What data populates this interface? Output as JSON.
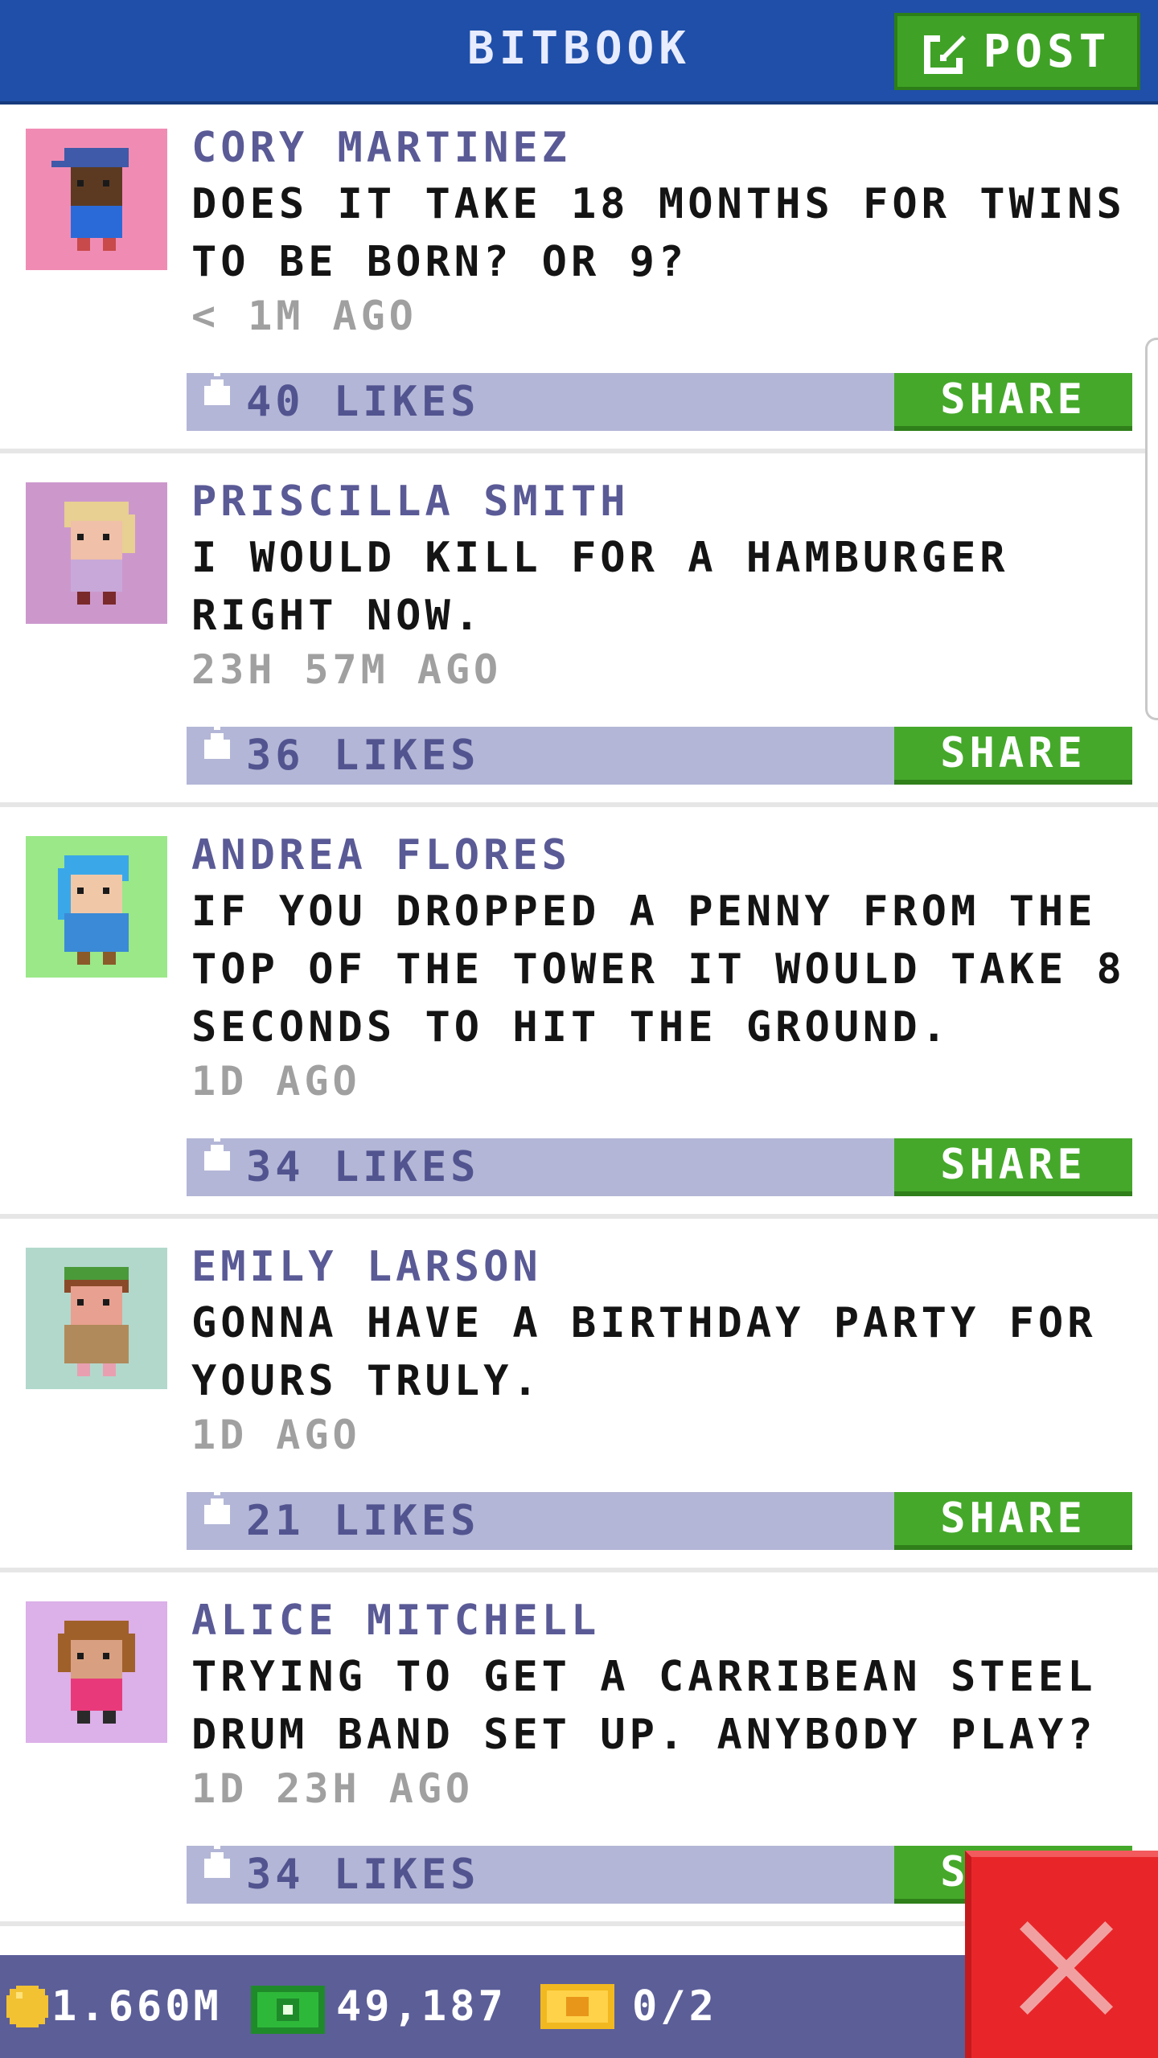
{
  "header": {
    "title": "BITBOOK",
    "post_label": "POST"
  },
  "posts": [
    {
      "author": "CORY MARTINEZ",
      "message": "DOES IT TAKE 18 MONTHS FOR TWINS TO BE BORN? OR 9?",
      "time": "< 1M AGO",
      "likes": "40 LIKES",
      "share": "SHARE",
      "avatar_bg": "#f08cb4"
    },
    {
      "author": "PRISCILLA SMITH",
      "message": "I WOULD KILL FOR A HAMBURGER RIGHT NOW.",
      "time": "23H 57M AGO",
      "likes": "36 LIKES",
      "share": "SHARE",
      "avatar_bg": "#cc98cc"
    },
    {
      "author": "ANDREA FLORES",
      "message": "IF YOU DROPPED A PENNY FROM THE TOP OF THE TOWER IT WOULD TAKE 8 SECONDS TO HIT THE GROUND.",
      "time": "1D AGO",
      "likes": "34 LIKES",
      "share": "SHARE",
      "avatar_bg": "#9ae888"
    },
    {
      "author": "EMILY LARSON",
      "message": "GONNA HAVE A BIRTHDAY PARTY FOR YOURS TRULY.",
      "time": "1D AGO",
      "likes": "21 LIKES",
      "share": "SHARE",
      "avatar_bg": "#b2d8cc"
    },
    {
      "author": "ALICE MITCHELL",
      "message": "TRYING TO GET A CARRIBEAN STEEL DRUM BAND SET UP. ANYBODY PLAY?",
      "time": "1D 23H AGO",
      "likes": "34 LIKES",
      "share": "SHARE",
      "avatar_bg": "#dcb0e8"
    }
  ],
  "footer": {
    "coins": "1.660M",
    "bux": "49,187",
    "tickets": "0/2"
  },
  "icons": {
    "post": "edit-icon",
    "like": "thumb-icon",
    "coin": "coin-icon",
    "bux": "bux-icon",
    "ticket": "ticket-icon",
    "close": "close-icon"
  },
  "colors": {
    "header": "#1f4fa8",
    "accent_green": "#45a82a",
    "likes_bar": "#b3b6d6",
    "footer": "#5c5e98",
    "close": "#e8262a"
  }
}
